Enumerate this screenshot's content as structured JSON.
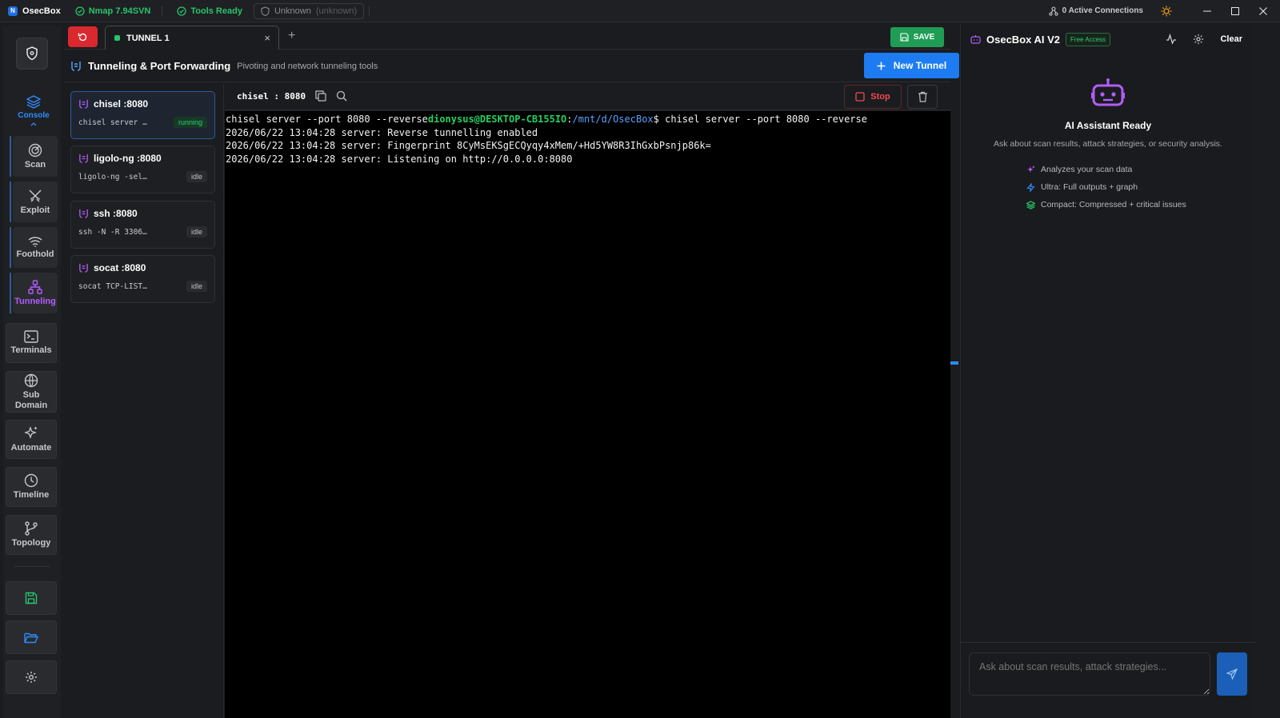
{
  "titlebar": {
    "app_name": "OsecBox",
    "app_logo_letter": "N",
    "nmap_status": "Nmap 7.94SVN",
    "tools_status": "Tools Ready",
    "host_name": "Unknown",
    "host_detail": "(unknown)",
    "connections": "0 Active Connections"
  },
  "rail": {
    "console_label": "Console",
    "sub_items": [
      {
        "label": "Scan",
        "icon": "radar-icon"
      },
      {
        "label": "Exploit",
        "icon": "crossed-swords-icon"
      },
      {
        "label": "Foothold",
        "icon": "wifi-icon"
      },
      {
        "label": "Tunneling",
        "icon": "network-icon"
      }
    ],
    "terminals_label": "Terminals",
    "subdomain_label": "Sub Domain",
    "automate_label": "Automate",
    "timeline_label": "Timeline",
    "topology_label": "Topology"
  },
  "tabs": {
    "active_tab": "TUNNEL 1",
    "add_symbol": "+",
    "close_symbol": "×",
    "save_label": "SAVE"
  },
  "header": {
    "title": "Tunneling & Port Forwarding",
    "subtitle": "Pivoting and network tunneling tools",
    "new_tunnel_label": "New Tunnel"
  },
  "tunnels": [
    {
      "name": "chisel :8080",
      "cmd": "chisel server …",
      "status": "running"
    },
    {
      "name": "ligolo-ng :8080",
      "cmd": "ligolo-ng -sel…",
      "status": "idle"
    },
    {
      "name": "ssh :8080",
      "cmd": "ssh -N -R 3306…",
      "status": "idle"
    },
    {
      "name": "socat :8080",
      "cmd": "socat TCP-LIST…",
      "status": "idle"
    }
  ],
  "terminal": {
    "label": "chisel : 8080",
    "stop_label": "Stop",
    "echo_cmd": "chisel server --port 8080 --reverse",
    "prompt_user": "dionysus@DESKTOP-CB155IO",
    "prompt_sep": ":",
    "prompt_path": "/mnt/d/OsecBox",
    "prompt_cmd": "$ chisel server --port 8080 --reverse",
    "log_lines": [
      "2026/06/22 13:04:28 server: Reverse tunnelling enabled",
      "2026/06/22 13:04:28 server: Fingerprint 8CyMsEKSgECQyqy4xMem/+Hd5YW8R3IhGxbPsnjp86k=",
      "2026/06/22 13:04:28 server: Listening on http://0.0.0.0:8080"
    ]
  },
  "ai": {
    "title": "OsecBox AI V2",
    "badge": "Free Access",
    "clear_label": "Clear",
    "ready_title": "AI Assistant Ready",
    "ready_desc": "Ask about scan results, attack strategies, or security analysis.",
    "features": [
      "Analyzes your scan data",
      "Ultra: Full outputs + graph",
      "Compact: Compressed + critical issues"
    ],
    "input_placeholder": "Ask about scan results, attack strategies..."
  },
  "colors": {
    "accent_blue": "#1d7cf2",
    "accent_green": "#1f9d55",
    "accent_red": "#d9282e",
    "accent_purple": "#b35cff"
  }
}
